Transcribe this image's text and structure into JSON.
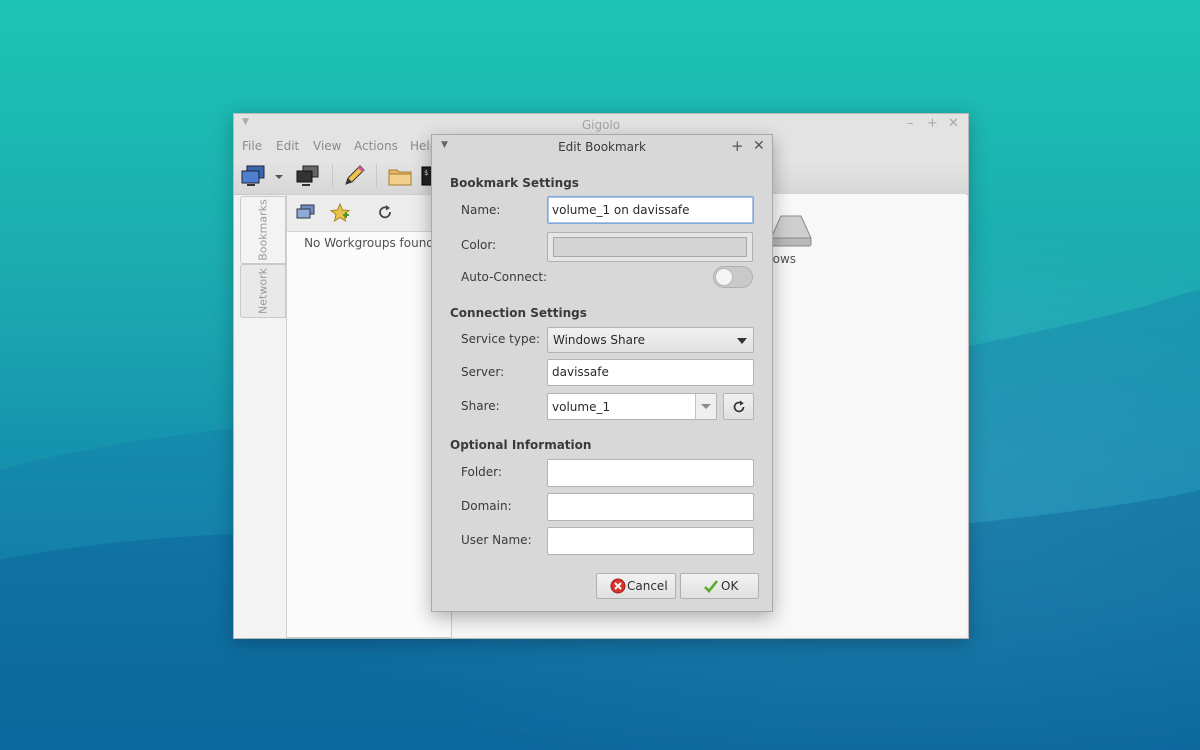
{
  "main_window": {
    "title": "Gigolo",
    "menu": [
      "File",
      "Edit",
      "View",
      "Actions",
      "Help"
    ],
    "side_tabs": [
      "Bookmarks",
      "Network"
    ],
    "left_pane_empty_text": "No Workgroups found",
    "right_pane_item_label_visible": "dows"
  },
  "dialog": {
    "title": "Edit Bookmark",
    "sections": {
      "bookmark": "Bookmark Settings",
      "connection": "Connection Settings",
      "optional": "Optional Information"
    },
    "labels": {
      "name": "Name:",
      "color": "Color:",
      "auto_connect": "Auto-Connect:",
      "service_type": "Service type:",
      "server": "Server:",
      "share": "Share:",
      "folder": "Folder:",
      "domain": "Domain:",
      "user_name": "User Name:"
    },
    "values": {
      "name": "volume_1 on davissafe",
      "auto_connect": false,
      "service_type": "Windows Share",
      "server": "davissafe",
      "share": "volume_1",
      "folder": "",
      "domain": "",
      "user_name": ""
    },
    "buttons": {
      "cancel": "Cancel",
      "ok": "OK"
    }
  },
  "colors": {
    "desktop_top": "#1ec4b3",
    "desktop_bottom": "#0d6aa0",
    "dialog_bg": "#d8d8d8",
    "cancel_icon": "#d9342b",
    "ok_icon": "#5aaa2a"
  }
}
